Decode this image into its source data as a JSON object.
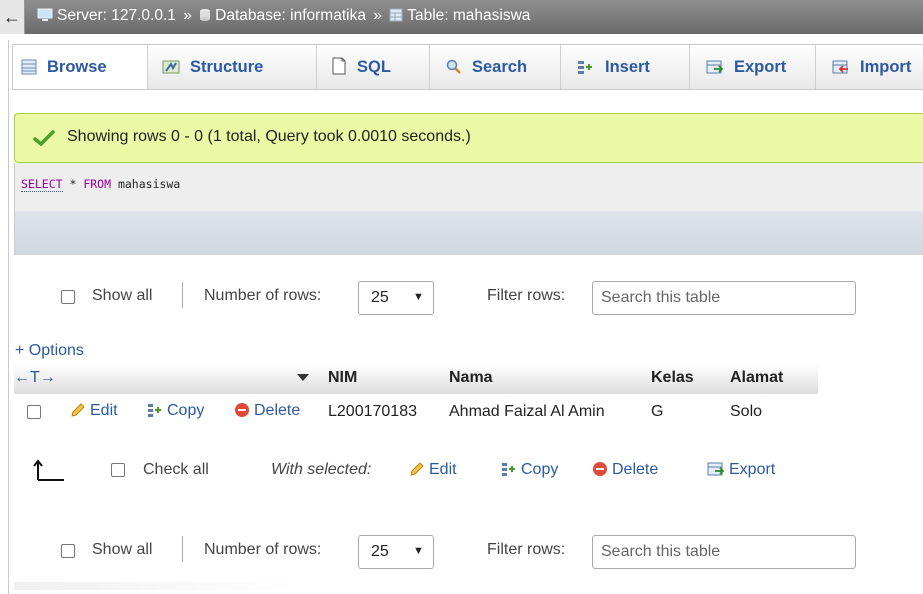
{
  "breadcrumb": {
    "server": "Server: 127.0.0.1",
    "database": "Database: informatika",
    "table": "Table: mahasiswa",
    "separator": "»"
  },
  "tabs": [
    {
      "label": "Browse"
    },
    {
      "label": "Structure"
    },
    {
      "label": "SQL"
    },
    {
      "label": "Search"
    },
    {
      "label": "Insert"
    },
    {
      "label": "Export"
    },
    {
      "label": "Import"
    }
  ],
  "message": {
    "text": "Showing rows 0 - 0 (1 total, Query took 0.0010 seconds.)"
  },
  "query": {
    "select": "SELECT",
    "star": " * ",
    "from": "FROM",
    "table": " mahasiswa"
  },
  "navigation": {
    "show_all": "Show all",
    "number_of_rows_label": "Number of rows:",
    "number_of_rows_value": "25",
    "filter_label": "Filter rows:",
    "filter_placeholder": "Search this table"
  },
  "options_link": "+ Options",
  "resize_arrows": "←T→",
  "table": {
    "columns": [
      "NIM",
      "Nama",
      "Kelas",
      "Alamat"
    ],
    "row_actions": {
      "edit": "Edit",
      "copy": "Copy",
      "delete": "Delete"
    },
    "rows": [
      [
        "L200170183",
        "Ahmad Faizal Al Amin",
        "G",
        "Solo"
      ]
    ]
  },
  "with_selected": {
    "check_all": "Check all",
    "label": "With selected:",
    "edit": "Edit",
    "copy": "Copy",
    "delete": "Delete",
    "export": "Export"
  },
  "colors": {
    "link": "#2c5aa0",
    "success_bg": "#ebf8a4",
    "success_border": "#a2d246",
    "topbar": "#7d7d7d"
  }
}
